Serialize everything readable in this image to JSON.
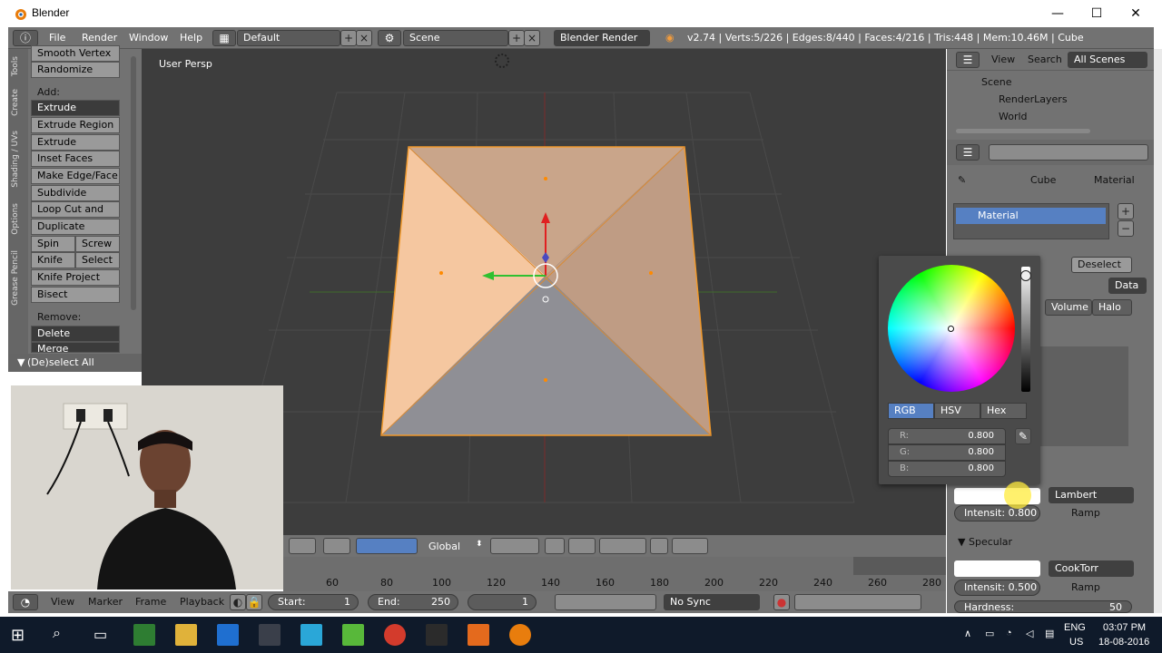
{
  "window": {
    "title": "Blender"
  },
  "menu": {
    "items": [
      "File",
      "Render",
      "Window",
      "Help"
    ],
    "layout": "Default",
    "scene": "Scene",
    "engine": "Blender Render",
    "stats": "v2.74 | Verts:5/226 | Edges:8/440 | Faces:4/216 | Tris:448 | Mem:10.46M | Cube"
  },
  "tool_shelf": {
    "tabs": [
      "Tools",
      "Create",
      "Shading / UVs",
      "Options",
      "Grease Pencil"
    ],
    "top_buttons": [
      "Smooth Vertex",
      "Randomize"
    ],
    "add_label": "Add:",
    "extrude": "Extrude",
    "add_buttons": [
      "Extrude Region",
      "Extrude Individual",
      "Inset Faces",
      "Make Edge/Face",
      "Subdivide",
      "Loop Cut and Slide",
      "Duplicate"
    ],
    "spin": "Spin",
    "screw": "Screw",
    "knife": "Knife",
    "select": "Select",
    "knife_project": "Knife Project",
    "bisect": "Bisect",
    "remove_label": "Remove:",
    "delete": "Delete",
    "merge": "Merge",
    "operator_panel": "(De)select All"
  },
  "viewport": {
    "label": "User Persp",
    "orientation": "Global"
  },
  "timeline": {
    "numbers": [
      "60",
      "80",
      "100",
      "120",
      "140",
      "160",
      "180",
      "200",
      "220",
      "240",
      "260",
      "280"
    ],
    "menu": [
      "View",
      "Marker",
      "Frame",
      "Playback"
    ],
    "start_label": "Start:",
    "start_value": "1",
    "end_label": "End:",
    "end_value": "250",
    "current": "1",
    "sync": "No Sync"
  },
  "outliner": {
    "view": "View",
    "search": "Search",
    "all_scenes": "All Scenes",
    "items": [
      "Scene",
      "RenderLayers",
      "World"
    ]
  },
  "properties": {
    "breadcrumb_object": "Cube",
    "breadcrumb_material": "Material",
    "material_slot": "Material",
    "deselect": "Deselect",
    "data": "Data",
    "volume": "Volume",
    "halo": "Halo",
    "diffuse_shader": "Lambert",
    "diffuse_intensity": "Intensit: 0.800",
    "ramp": "Ramp",
    "specular_header": "Specular",
    "specular_shader": "CookTorr",
    "specular_intensity": "Intensit: 0.500",
    "hardness": "Hardness:",
    "hardness_value": "50"
  },
  "color_picker": {
    "tabs": [
      "RGB",
      "HSV",
      "Hex"
    ],
    "r_label": "R:",
    "r_value": "0.800",
    "g_label": "G:",
    "g_value": "0.800",
    "b_label": "B:",
    "b_value": "0.800"
  },
  "taskbar": {
    "lang1": "ENG",
    "lang2": "US",
    "time": "03:07 PM",
    "date": "18-08-2016"
  },
  "colors": {
    "blender_bg": "#727272",
    "viewport_bg": "#3d3d3d",
    "selection_blue": "#5680c2",
    "face_peach": "#f6c9a5",
    "taskbar": "#0f1a2a"
  }
}
